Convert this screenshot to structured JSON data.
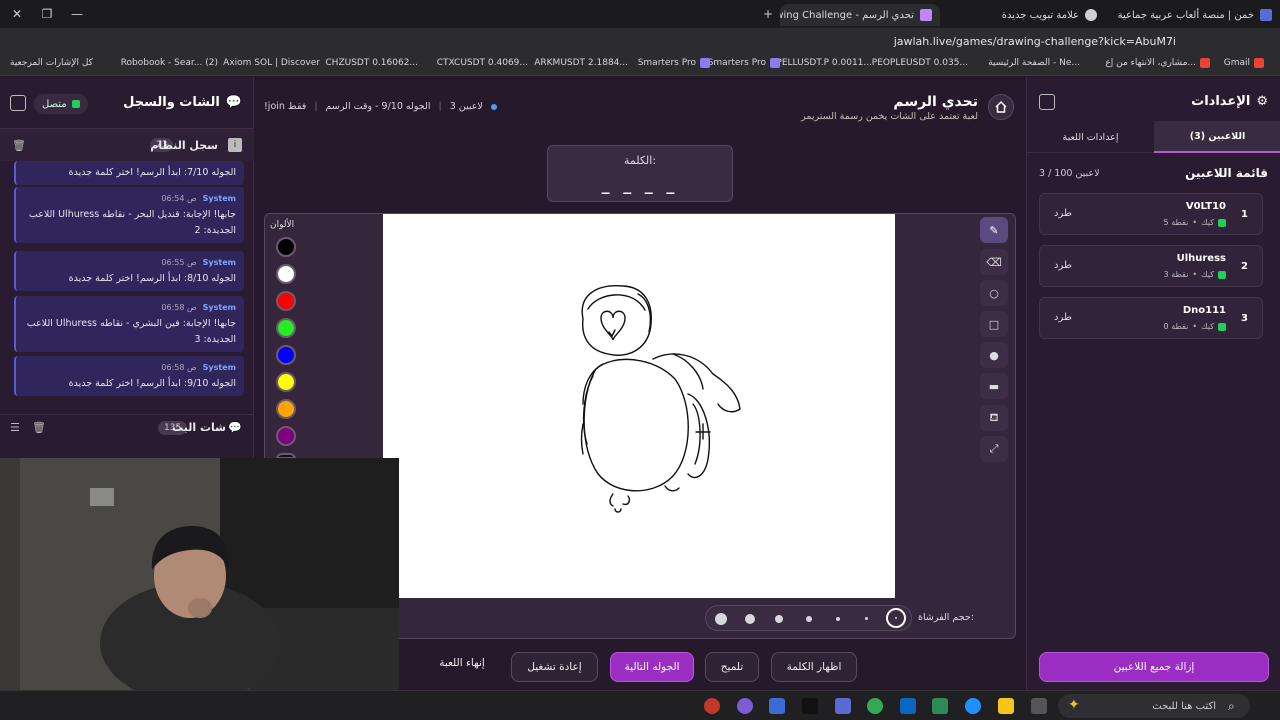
{
  "browser": {
    "tabs": [
      {
        "title": "خمن | منصة ألعاب عربية جماعية",
        "favicon_color": "#5a6bd6"
      },
      {
        "title": "علامة تبويب جديدة",
        "favicon_color": "#cfcfd4"
      },
      {
        "title": "تحدي الرسم - Drawing Challenge",
        "favicon_color": "#c084fc"
      }
    ],
    "url": "jawlah.live/games/drawing-challenge?kick=AbuM7i",
    "bookmarks": [
      "Gmail",
      "مشاري، الانتهاء من إع...",
      "الصفحة الرئيسية - Ne...",
      "PEOPLEUSDT 0.035...",
      "SPELLUSDT.P 0.0011...",
      "Smarters Pro",
      "Smarters Pro",
      "ARKMUSDT 2.1884...",
      "CTXCUSDT 0.4069...",
      "CHZUSDT 0.16062...",
      "Axiom SOL | Discover",
      "Robobook - Sear... (2)",
      "كل الإشارات المرجعية"
    ]
  },
  "left": {
    "title": "الشات والسجل",
    "status": "متصل",
    "system_log": {
      "title": "سجل النظام",
      "count": "23"
    },
    "messages": [
      {
        "sender": "",
        "time": "",
        "text": "الجوله 7/10: ابدأ الرسم! اختر كلمة جديدة"
      },
      {
        "sender": "System",
        "time": "06:54 ص",
        "text": "اللاعب Ulhuress جابها! الإجابة: قنديل البحر - نقاطه الجديدة: 2"
      },
      {
        "sender": "System",
        "time": "06:55 ص",
        "text": "الجوله 8/10: ابدأ الرسم! اختر كلمة جديدة"
      },
      {
        "sender": "System",
        "time": "06:58 ص",
        "text": "اللاعب Ulhuress جابها! الإجابة: فين البشري - نقاطه الجديدة: 3"
      },
      {
        "sender": "System",
        "time": "06:58 ص",
        "text": "الجوله 9/10: ابدأ الرسم! اختر كلمة جديدة"
      }
    ],
    "stream_chat": {
      "title": "شات البث",
      "count": "135"
    }
  },
  "main": {
    "title": "تحدي الرسم",
    "subtitle": "لعبة تعتمد على الشات يخمن رسمة الستريمر",
    "players_info": "3 لاعبين",
    "round_info": "الجوله 9/10 - وقت الرسم",
    "join_hint": "!join فقط",
    "word_label": "الكلمة:",
    "word_blanks": "_ _ _ _",
    "colors_label": "الألوان",
    "colors": [
      "#000000",
      "#ffffff",
      "#ff0000",
      "#22ee22",
      "#0000ff",
      "#ffff00",
      "#ffa500",
      "#800080",
      "#111111"
    ],
    "brush_label": "حجم الفرشاة:",
    "tools": [
      "pencil-icon",
      "eraser-icon",
      "circle-icon",
      "rectangle-icon",
      "fill-circle-icon",
      "fill-rect-icon",
      "bucket-icon",
      "line-icon"
    ],
    "buttons": {
      "show_word": "اظهار الكلمة",
      "hint": "تلميح",
      "next_round": "الجوله التالية",
      "restart": "إعادة تشغيل",
      "end_game": "إنهاء اللعبة"
    }
  },
  "right": {
    "title": "الإعدادات",
    "tabs": {
      "players": "اللاعبين (3)",
      "game_settings": "إعدادات اللعبة"
    },
    "list_title": "قائمة اللاعبين",
    "list_count": "3 / 100 لاعبين",
    "players": [
      {
        "rank": "1",
        "name": "V0LT10",
        "points": "5 نقطة",
        "platform": "كيك",
        "action": "طرد"
      },
      {
        "rank": "2",
        "name": "Ulhuress",
        "points": "3 نقطة",
        "platform": "كيك",
        "action": "طرد"
      },
      {
        "rank": "3",
        "name": "Dno111",
        "points": "0 نقطة",
        "platform": "كيك",
        "action": "طرد"
      }
    ],
    "remove_all": "إزالة جميع اللاعبين"
  },
  "taskbar": {
    "search_placeholder": "اكتب هنا للبحث"
  }
}
